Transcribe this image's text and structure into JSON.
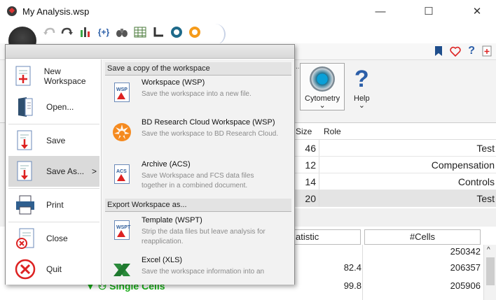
{
  "window": {
    "title": "My Analysis.wsp",
    "minimize": "—",
    "maximize": "☐",
    "close": "✕"
  },
  "quick_access": {
    "icons": [
      "undo-icon",
      "redo-icon",
      "layout-icon",
      "formula-icon",
      "binoculars-icon",
      "table-icon",
      "axis-icon",
      "record-icon",
      "sun-icon"
    ]
  },
  "ribbon": {
    "ellipsis": "...",
    "cytometry_label": "Cytometry",
    "help_label": "Help",
    "chevron": "⌄",
    "right_icons": {
      "bookmark": "🔖",
      "heart": "♡",
      "help": "?",
      "add": "+"
    }
  },
  "top_table": {
    "headers": [
      "Size",
      "Role"
    ],
    "rows": [
      {
        "size": "46",
        "role": "Test",
        "selected": false
      },
      {
        "size": "12",
        "role": "Compensation",
        "selected": false
      },
      {
        "size": "14",
        "role": "Controls",
        "selected": false
      },
      {
        "size": "20",
        "role": "Test",
        "selected": true
      }
    ]
  },
  "bottom_table": {
    "stat_header": "atistic",
    "cells_header": "#Cells",
    "rows": [
      {
        "stat": "",
        "cells": "250342",
        "gate": ""
      },
      {
        "stat": "82.4",
        "cells": "206357",
        "gate": ""
      },
      {
        "stat": "99.8",
        "cells": "205906",
        "gate": "▼ ⚇ Single Cells"
      }
    ],
    "scroll_up": "^"
  },
  "app_menu": {
    "left_items": [
      {
        "label": "New Workspace",
        "icon": "new-workspace-icon"
      },
      {
        "label": "Open...",
        "icon": "open-icon"
      },
      {
        "label": "Save",
        "icon": "save-icon"
      },
      {
        "label": "Save As...",
        "icon": "save-as-icon",
        "submenu": ">"
      },
      {
        "label": "Print",
        "icon": "print-icon"
      },
      {
        "label": "Close",
        "icon": "close-doc-icon"
      },
      {
        "label": "Quit",
        "icon": "quit-icon"
      }
    ],
    "sections": [
      {
        "heading": "Save a copy of the workspace",
        "items": [
          {
            "title": "Workspace (WSP)",
            "desc": "Save the workspace into a new file.",
            "icon": "wsp-file-icon",
            "tag": "WSP"
          },
          {
            "title": "BD Research Cloud Workspace (WSP)",
            "desc": "Save the workspace to BD Research Cloud.",
            "icon": "bd-cloud-icon"
          },
          {
            "title": "Archive (ACS)",
            "desc": "Save Workspace and FCS data files together in a combined document.",
            "icon": "acs-file-icon",
            "tag": "ACS"
          }
        ]
      },
      {
        "heading": "Export Workspace as...",
        "items": [
          {
            "title": "Template (WSPT)",
            "desc": "Strip the data files but leave analysis for reapplication.",
            "icon": "wspt-file-icon",
            "tag": "WSPT"
          },
          {
            "title": "Excel (XLS)",
            "desc": "Save the workspace information into an",
            "icon": "excel-icon"
          }
        ]
      }
    ]
  },
  "colors": {
    "gate_green": "#18b018",
    "help_blue": "#2b5ea8",
    "accent_red": "#d22"
  }
}
